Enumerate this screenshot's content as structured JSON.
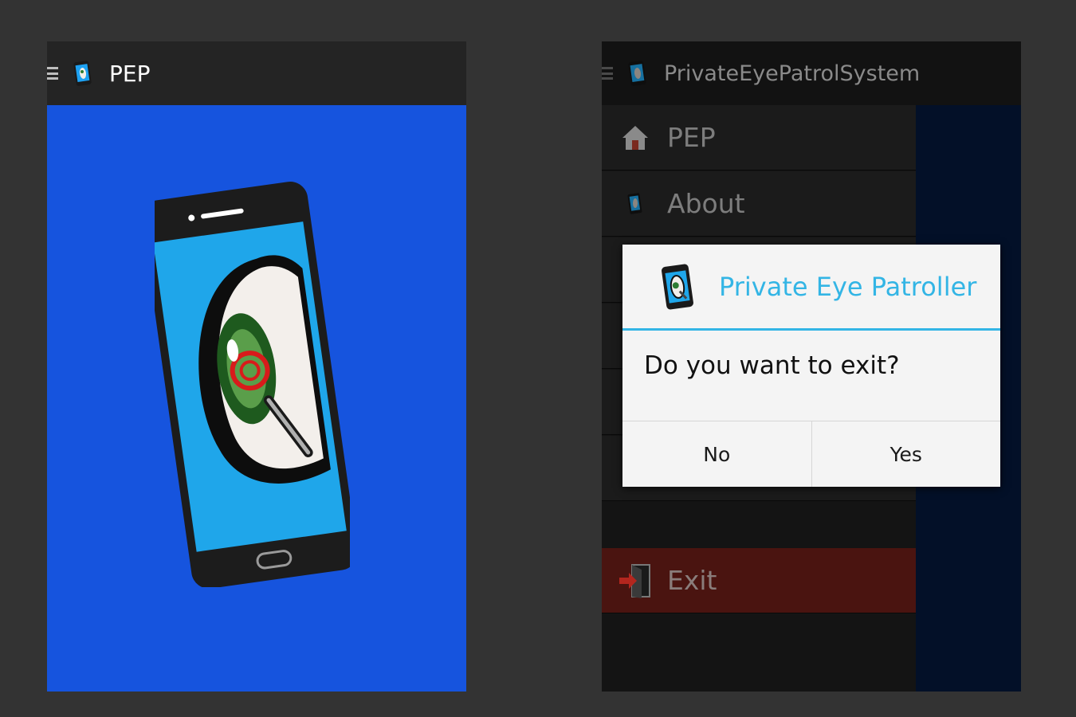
{
  "left_screen": {
    "action_bar": {
      "title": "PEP"
    }
  },
  "right_screen": {
    "action_bar": {
      "title": "PrivateEyePatrolSystem"
    },
    "drawer": {
      "items": [
        {
          "label": "PEP",
          "icon": "home-icon"
        },
        {
          "label": "About",
          "icon": "app-logo-icon"
        },
        {
          "label": "Exit",
          "icon": "exit-door-icon"
        }
      ]
    },
    "dialog": {
      "title": "Private Eye Patroller",
      "message": "Do you want to exit?",
      "negative_label": "No",
      "positive_label": "Yes"
    }
  },
  "colors": {
    "splash_background": "#1654de",
    "dialog_accent": "#33b5e5",
    "exit_item_background": "#4a1410"
  }
}
